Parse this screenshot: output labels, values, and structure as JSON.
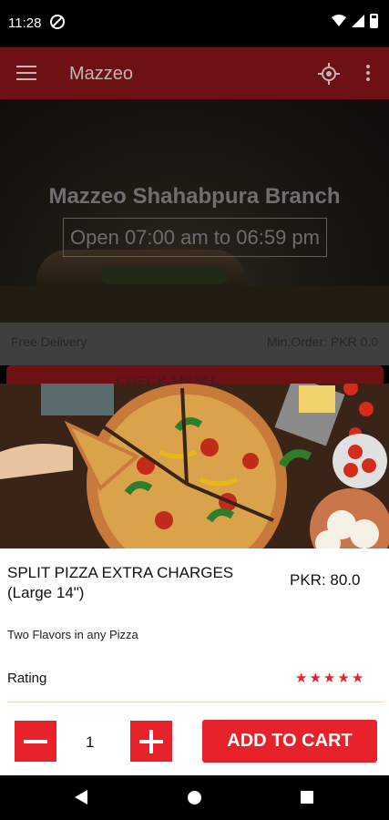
{
  "status_bar": {
    "time": "11:28",
    "icons": [
      "vpn-icon",
      "wifi-icon",
      "signal-icon",
      "battery-icon"
    ]
  },
  "app_bar": {
    "title": "Mazzeo",
    "icons": [
      "menu-icon",
      "locate-icon",
      "more-vert-icon"
    ]
  },
  "hero": {
    "branch_name": "Mazzeo Shahabpura Branch",
    "hours": "Open 07:00 am to 06:59 pm"
  },
  "info_row": {
    "free_delivery": "Free Delivery",
    "min_order": "Min.Order: PKR 0.0"
  },
  "check_menu": {
    "label": "CHECK MENU"
  },
  "product": {
    "name": "SPLIT PIZZA EXTRA CHARGES (Large 14\")",
    "price": "PKR: 80.0",
    "description": "Two Flavors in any Pizza",
    "rating_label": "Rating",
    "rating": 5,
    "rating_max": 5
  },
  "cart": {
    "quantity": "1",
    "add_label": "ADD TO CART"
  },
  "colors": {
    "accent": "#e8222a",
    "app_bar_dimmed": "#6e1115",
    "star": "#e5232a"
  }
}
